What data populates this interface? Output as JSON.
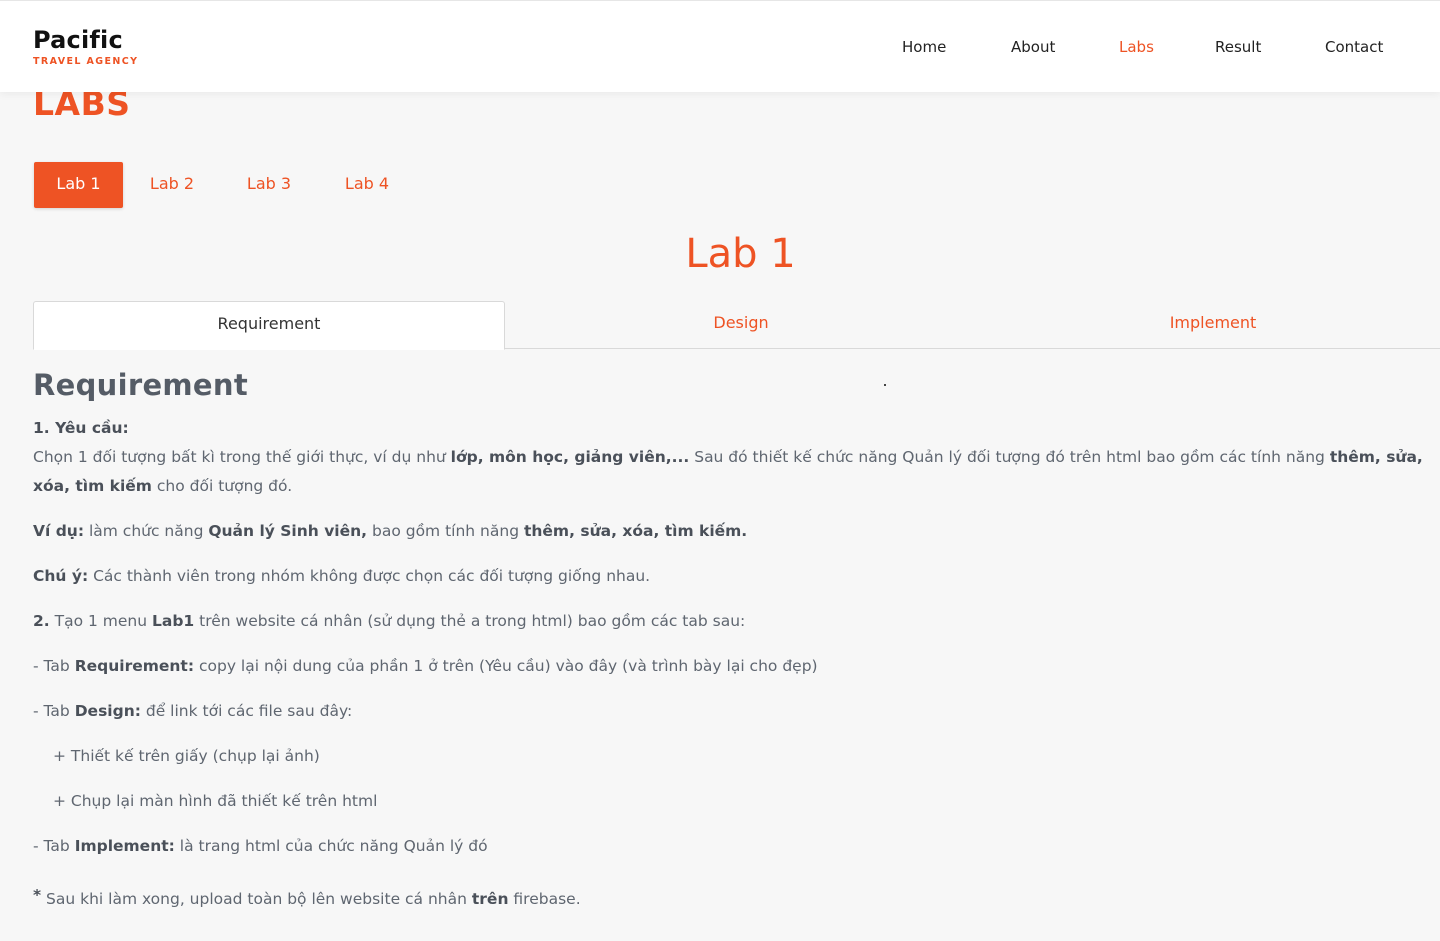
{
  "header": {
    "logo_title": "Pacific",
    "logo_subtitle": "TRAVEL AGENCY",
    "nav": [
      "Home",
      "About",
      "Labs",
      "Result",
      "Contact"
    ],
    "active_nav": "Labs"
  },
  "page_title": "LABS",
  "lab_tabs": [
    "Lab 1",
    "Lab 2",
    "Lab 3",
    "Lab 4"
  ],
  "active_lab": "Lab 1",
  "lab_heading": "Lab 1",
  "sub_tabs": [
    "Requirement",
    "Design",
    "Implement"
  ],
  "active_sub_tab": "Requirement",
  "content": {
    "heading": "Requirement",
    "section1_title": "1. Yêu cầu:",
    "p1_a": "Chọn 1 đối tượng bất kì trong thế giới thực, ví dụ như ",
    "p1_b": "lớp, môn học, giảng viên,...",
    "p1_c": " Sau đó thiết kế chức năng Quản lý đối tượng đó trên html bao gồm các tính năng ",
    "p1_d": "thêm, sửa, xóa, tìm kiếm",
    "p1_e": " cho đối tượng đó.",
    "example_label": "Ví dụ:",
    "example_a": " làm chức năng ",
    "example_b": "Quản lý Sinh viên,",
    "example_c": " bao gồm tính năng ",
    "example_d": "thêm, sửa, xóa, tìm kiếm.",
    "note_label": "Chú ý:",
    "note_text": " Các thành viên trong nhóm không được chọn các đối tượng giống nhau.",
    "s2_a": "2.",
    "s2_b": " Tạo 1 menu ",
    "s2_c": "Lab1",
    "s2_d": " trên website cá nhân (sử dụng thẻ a trong html) bao gồm các tab sau:",
    "tab_req_a": "- Tab ",
    "tab_req_b": "Requirement:",
    "tab_req_c": " copy lại nội dung của phần 1 ở trên (Yêu cầu) vào đây (và trình bày lại cho đẹp)",
    "tab_des_a": "- Tab ",
    "tab_des_b": "Design:",
    "tab_des_c": " để link tới các file sau đây:",
    "des_item1": "+ Thiết kế trên giấy (chụp lại ảnh)",
    "des_item2": "+ Chụp lại màn hình đã thiết kế trên html",
    "tab_imp_a": "- Tab ",
    "tab_imp_b": "Implement:",
    "tab_imp_c": " là trang html của chức năng Quản lý đó",
    "final_star": "*",
    "final_a": " Sau khi làm xong, upload toàn bộ lên website cá nhân ",
    "final_b": "trên",
    "final_c": " firebase."
  },
  "colors": {
    "accent": "#ee5324",
    "text": "#5f6670",
    "background": "#f7f7f7"
  }
}
